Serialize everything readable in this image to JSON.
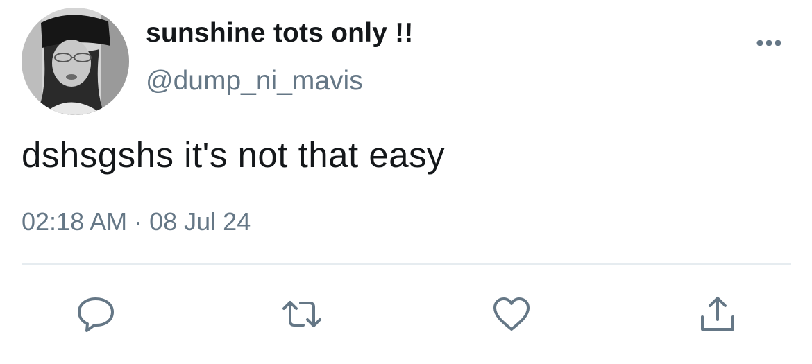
{
  "tweet": {
    "display_name": "sunshine tots only !!",
    "handle": "@dump_ni_mavis",
    "text": "dshsgshs it's not that easy",
    "time": "02:18 AM",
    "separator": "·",
    "date": "08 Jul 24"
  },
  "actions": {
    "reply_icon": "speech-bubble-icon",
    "retweet_icon": "retweet-arrows-icon",
    "like_icon": "heart-outline-icon",
    "share_icon": "share-upload-icon",
    "more_icon": "ellipsis-icon",
    "icon_color": "#657786"
  },
  "colors": {
    "name": "#14171a",
    "secondary": "#657786",
    "divider": "#e6ecf0",
    "background": "#ffffff"
  }
}
